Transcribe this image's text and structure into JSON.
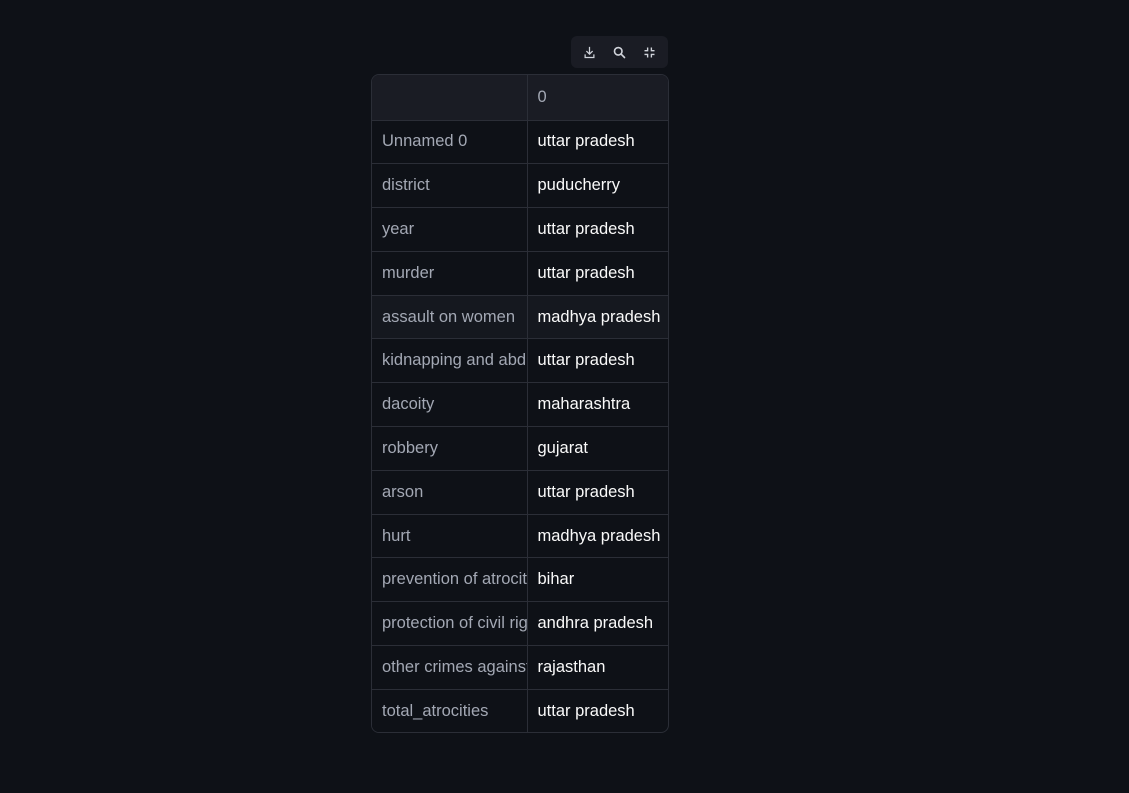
{
  "toolbar": {
    "download_icon": "download-icon",
    "search_icon": "search-icon",
    "fullscreen_icon": "exit-fullscreen-icon"
  },
  "table": {
    "columns": [
      "",
      "0"
    ],
    "rows": [
      {
        "label": "Unnamed 0",
        "value": "uttar pradesh"
      },
      {
        "label": "district",
        "value": "puducherry"
      },
      {
        "label": "year",
        "value": "uttar pradesh"
      },
      {
        "label": "murder",
        "value": "uttar pradesh"
      },
      {
        "label": "assault on women",
        "value": "madhya pradesh"
      },
      {
        "label": "kidnapping and abduction",
        "value": "uttar pradesh"
      },
      {
        "label": "dacoity",
        "value": "maharashtra"
      },
      {
        "label": "robbery",
        "value": "gujarat"
      },
      {
        "label": "arson",
        "value": "uttar pradesh"
      },
      {
        "label": "hurt",
        "value": "madhya pradesh"
      },
      {
        "label": "prevention of atrocities",
        "value": "bihar"
      },
      {
        "label": "protection of civil rights",
        "value": "andhra pradesh"
      },
      {
        "label": "other crimes against",
        "value": "rajasthan"
      },
      {
        "label": "total_atrocities",
        "value": "uttar pradesh"
      }
    ]
  }
}
